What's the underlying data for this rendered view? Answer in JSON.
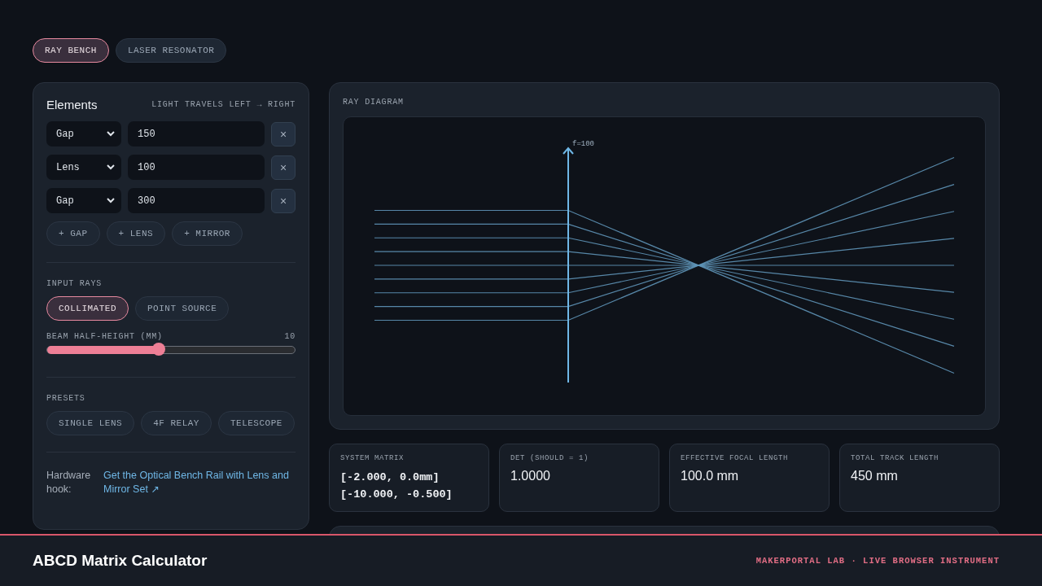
{
  "mode_tabs": [
    {
      "label": "RAY BENCH",
      "selected": true
    },
    {
      "label": "LASER RESONATOR",
      "selected": false
    }
  ],
  "elements_panel": {
    "title": "Elements",
    "hint": "LIGHT TRAVELS LEFT → RIGHT",
    "elements": [
      {
        "type": "Gap",
        "value": "150",
        "remove": "×"
      },
      {
        "type": "Lens",
        "value": "100",
        "remove": "×"
      },
      {
        "type": "Gap",
        "value": "300",
        "remove": "×"
      }
    ],
    "add_buttons": [
      "+ GAP",
      "+ LENS",
      "+ MIRROR"
    ],
    "input_rays": {
      "label": "INPUT RAYS",
      "options": [
        {
          "label": "COLLIMATED",
          "selected": true
        },
        {
          "label": "POINT SOURCE",
          "selected": false
        }
      ]
    },
    "beam_slider": {
      "label": "BEAM HALF-HEIGHT (MM)",
      "reading": "10",
      "level": 0.45
    },
    "presets": {
      "label": "PRESETS",
      "buttons": [
        "SINGLE LENS",
        "4F RELAY",
        "TELESCOPE"
      ]
    },
    "hardware": {
      "label": "Hardware hook:",
      "link": "Get the Optical Bench Rail with Lens and Mirror Set ↗"
    }
  },
  "ray_diagram": {
    "title": "RAY DIAGRAM",
    "lens_label": "f=100"
  },
  "stats": [
    {
      "label": "SYSTEM MATRIX",
      "kind": "matrix",
      "lines": [
        "[-2.000, 0.0mm]",
        "[-10.000, -0.500]"
      ]
    },
    {
      "label": "DET (SHOULD = 1)",
      "kind": "value",
      "lines": [
        "1.0000"
      ]
    },
    {
      "label": "EFFECTIVE FOCAL LENGTH",
      "kind": "value",
      "lines": [
        "100.0 mm"
      ]
    },
    {
      "label": "TOTAL TRACK LENGTH",
      "kind": "value",
      "lines": [
        "450 mm"
      ]
    }
  ],
  "footer": {
    "title": "ABCD Matrix Calculator",
    "tagline": "MAKERPORTAL LAB · LIVE BROWSER INSTRUMENT"
  }
}
